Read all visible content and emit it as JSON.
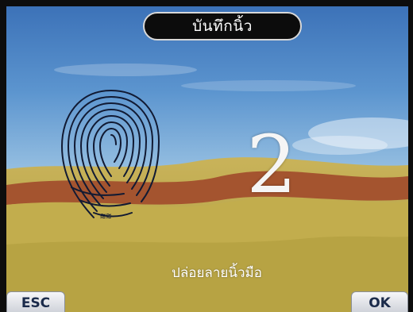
{
  "header": {
    "title": "บันทึกนิ้ว"
  },
  "enroll": {
    "step": "2",
    "instruction": "ปล่อยลายนิ้วมือ"
  },
  "buttons": {
    "esc_label": "ESC",
    "ok_label": "OK"
  },
  "icons": {
    "fingerprint": "fingerprint-icon"
  },
  "colors": {
    "title_bg": "#0c0c0c",
    "sky_top": "#3c72b8",
    "sand": "#b9a643",
    "ridge": "#a4542f"
  }
}
